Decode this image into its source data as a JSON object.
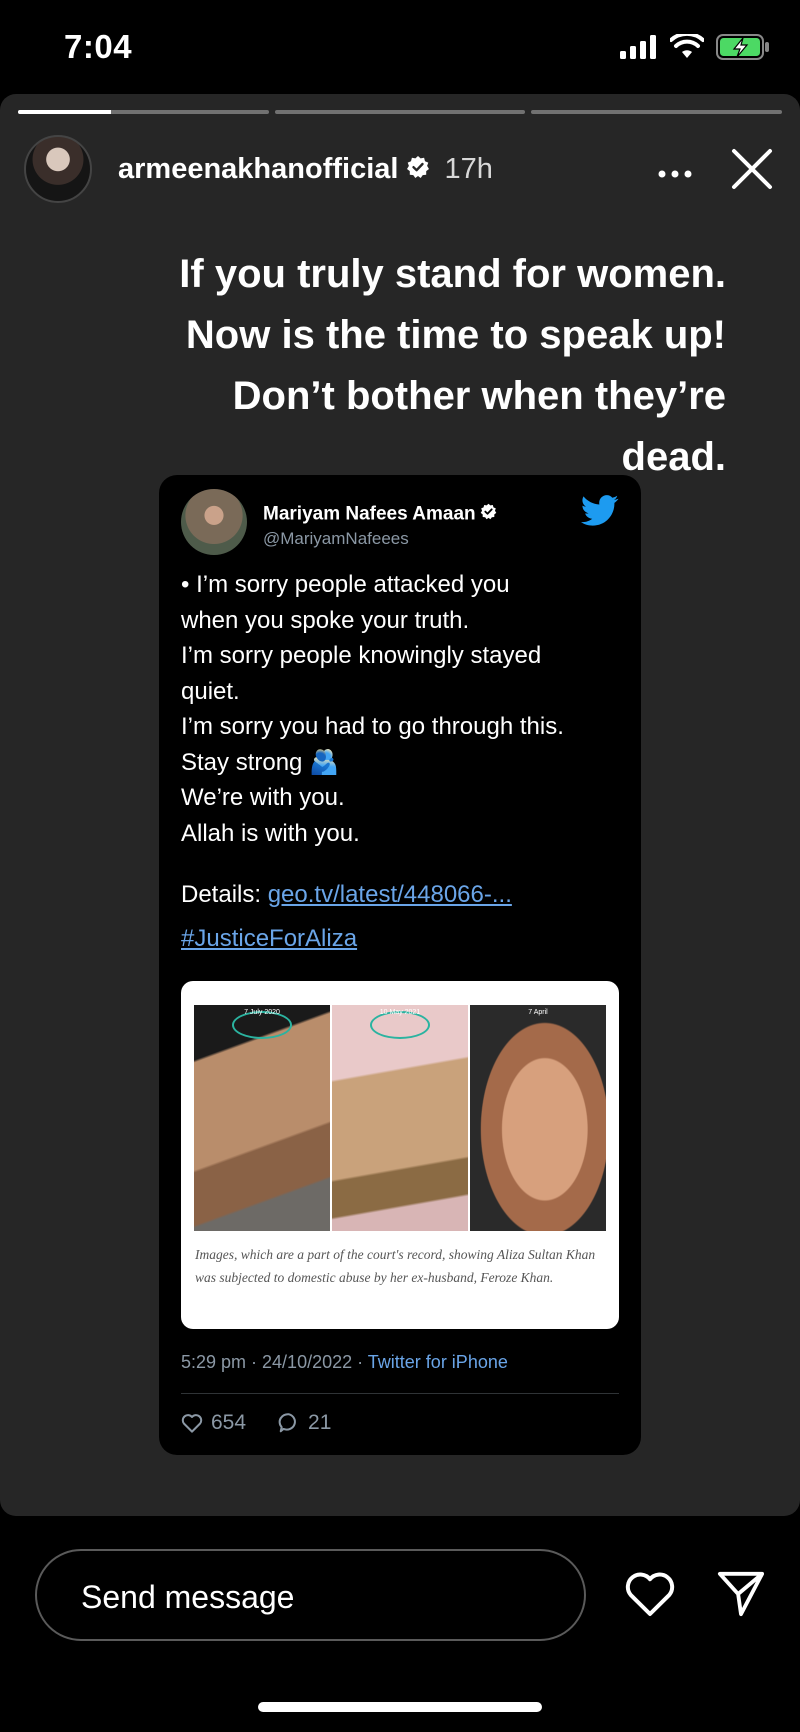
{
  "status_bar": {
    "time": "7:04",
    "icons": [
      "cellular-signal-icon",
      "wifi-icon",
      "battery-charging-icon"
    ],
    "battery_color": "#4cd964"
  },
  "story": {
    "progress": [
      0.37,
      0,
      0
    ],
    "username": "armeenakhanofficial",
    "verified": true,
    "time_ago": "17h",
    "more_icon": "more-icon",
    "close_icon": "close-icon",
    "caption_lines": [
      "If you truly stand for women.",
      "Now is the time to speak up!",
      "Don’t bother when they’re",
      "dead."
    ],
    "background_color": "#262626"
  },
  "tweet": {
    "name": "Mariyam Nafees Amaan",
    "handle": "@MariyamNafeees",
    "verified": true,
    "brand_icon": "twitter-bird-icon",
    "body_lines": [
      "• I’m sorry people attacked you",
      "when you spoke your truth.",
      "I’m sorry people knowingly stayed",
      "quiet.",
      "I’m sorry you had to go through this.",
      "Stay strong 🫂",
      "We’re with you.",
      "Allah is with you."
    ],
    "details_label": "Details:",
    "details_link": "geo.tv/latest/448066-...",
    "hashtag": "#JusticeForAliza",
    "media": {
      "photo_dates": [
        "7 July 2020",
        "10 May 2021",
        "7 April"
      ],
      "caption": "Images, which are a part of the court's record, showing Aliza Sultan Khan was subjected to domestic abuse by her ex-husband, Feroze Khan."
    },
    "timestamp": "5:29 pm · 24/10/2022 · ",
    "source": "Twitter for iPhone",
    "likes": "654",
    "replies": "21",
    "link_color": "#6aa5e8"
  },
  "bottom_bar": {
    "message_placeholder": "Send message",
    "like_icon": "heart-icon",
    "share_icon": "send-icon"
  }
}
